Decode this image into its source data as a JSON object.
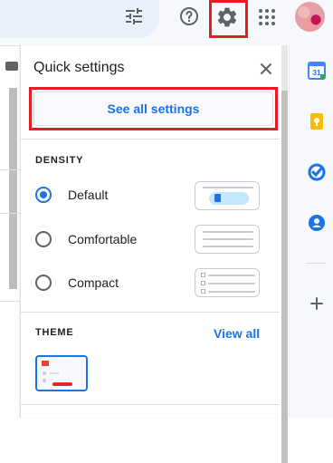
{
  "header": {
    "icons": [
      "tune-icon",
      "help-icon",
      "gear-icon",
      "apps-icon",
      "avatar"
    ]
  },
  "quick_settings": {
    "title": "Quick settings",
    "see_all_label": "See all settings",
    "density": {
      "label": "DENSITY",
      "options": [
        {
          "label": "Default",
          "selected": true
        },
        {
          "label": "Comfortable",
          "selected": false
        },
        {
          "label": "Compact",
          "selected": false
        }
      ]
    },
    "theme": {
      "label": "THEME",
      "view_all_label": "View all"
    }
  },
  "right_rail": {
    "calendar_day": "31",
    "icons": [
      "calendar-icon",
      "keep-icon",
      "tasks-icon",
      "contacts-icon",
      "add-icon"
    ]
  },
  "colors": {
    "accent": "#1a73e8",
    "highlight_box": "#e51c23"
  }
}
